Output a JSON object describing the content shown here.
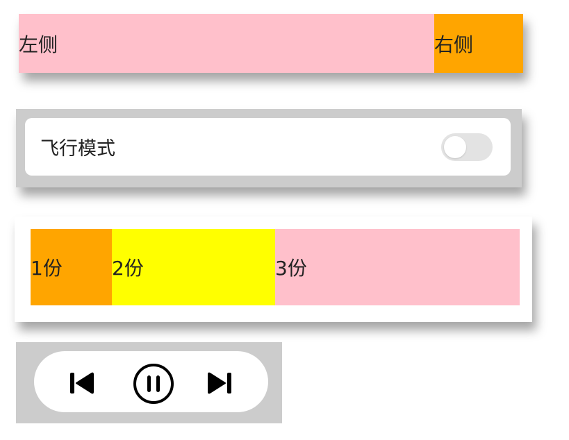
{
  "split_row": {
    "left_label": "左侧",
    "right_label": "右侧"
  },
  "settings_row": {
    "label": "飞行模式",
    "toggle_on": false
  },
  "ratio_row": {
    "segments": [
      {
        "label": "1份",
        "color": "#ffa500"
      },
      {
        "label": "2份",
        "color": "#ffff00"
      },
      {
        "label": "3份",
        "color": "#ffc0cb"
      }
    ]
  },
  "player": {
    "icons": [
      "skip-previous-icon",
      "pause-icon",
      "skip-next-icon"
    ]
  },
  "colors": {
    "pink": "#ffc0cb",
    "orange": "#ffa500",
    "yellow": "#ffff00",
    "gray": "#cccccc"
  }
}
